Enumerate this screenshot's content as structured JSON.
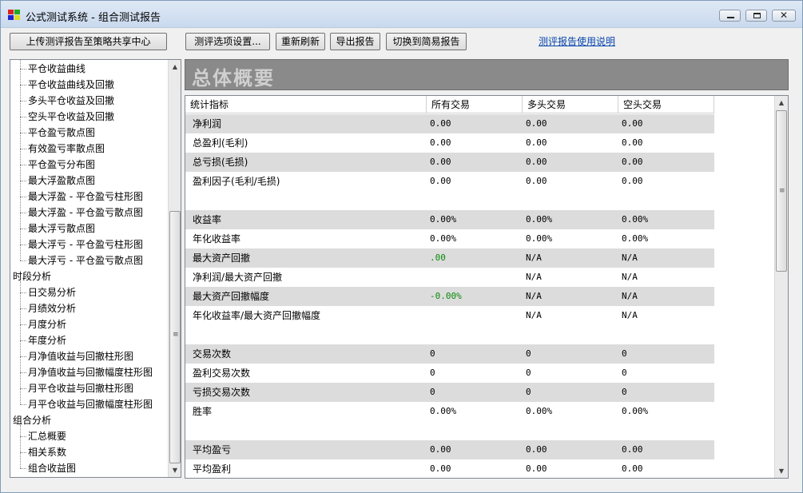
{
  "window": {
    "title": "公式测试系统 - 组合测试报告"
  },
  "toolbar": {
    "upload": "上传测评报告至策略共享中心",
    "options": "测评选项设置...",
    "refresh": "重新刷新",
    "export": "导出报告",
    "switch": "切换到简易报告",
    "help": "测评报告使用说明"
  },
  "tree": {
    "items": [
      {
        "label": "平仓收益曲线",
        "level": 1
      },
      {
        "label": "平仓收益曲线及回撤",
        "level": 1
      },
      {
        "label": "多头平仓收益及回撤",
        "level": 1
      },
      {
        "label": "空头平仓收益及回撤",
        "level": 1
      },
      {
        "label": "平仓盈亏散点图",
        "level": 1
      },
      {
        "label": "有效盈亏率散点图",
        "level": 1
      },
      {
        "label": "平仓盈亏分布图",
        "level": 1
      },
      {
        "label": "最大浮盈散点图",
        "level": 1
      },
      {
        "label": "最大浮盈 - 平仓盈亏柱形图",
        "level": 1
      },
      {
        "label": "最大浮盈 - 平仓盈亏散点图",
        "level": 1
      },
      {
        "label": "最大浮亏散点图",
        "level": 1
      },
      {
        "label": "最大浮亏 - 平仓盈亏柱形图",
        "level": 1
      },
      {
        "label": "最大浮亏 - 平仓盈亏散点图",
        "level": 1
      },
      {
        "label": "时段分析",
        "level": 0
      },
      {
        "label": "日交易分析",
        "level": 1
      },
      {
        "label": "月绩效分析",
        "level": 1
      },
      {
        "label": "月度分析",
        "level": 1
      },
      {
        "label": "年度分析",
        "level": 1
      },
      {
        "label": "月净值收益与回撤柱形图",
        "level": 1
      },
      {
        "label": "月净值收益与回撤幅度柱形图",
        "level": 1
      },
      {
        "label": "月平仓收益与回撤柱形图",
        "level": 1
      },
      {
        "label": "月平仓收益与回撤幅度柱形图",
        "level": 1
      },
      {
        "label": "组合分析",
        "level": 0
      },
      {
        "label": "汇总概要",
        "level": 1
      },
      {
        "label": "相关系数",
        "level": 1
      },
      {
        "label": "组合收益图",
        "level": 1
      }
    ]
  },
  "report": {
    "title": "总体概要",
    "columns": [
      "统计指标",
      "所有交易",
      "多头交易",
      "空头交易"
    ],
    "rows": [
      {
        "label": "净利润",
        "all": "0.00",
        "long": "0.00",
        "short": "0.00",
        "gray": true
      },
      {
        "label": "总盈利(毛利)",
        "all": "0.00",
        "long": "0.00",
        "short": "0.00",
        "gray": false
      },
      {
        "label": "总亏损(毛损)",
        "all": "0.00",
        "long": "0.00",
        "short": "0.00",
        "gray": true
      },
      {
        "label": "盈利因子(毛利/毛损)",
        "all": "0.00",
        "long": "0.00",
        "short": "0.00",
        "gray": false
      },
      {
        "label": "",
        "all": "",
        "long": "",
        "short": "",
        "gray": false
      },
      {
        "label": "收益率",
        "all": "0.00%",
        "long": "0.00%",
        "short": "0.00%",
        "gray": true
      },
      {
        "label": "年化收益率",
        "all": "0.00%",
        "long": "0.00%",
        "short": "0.00%",
        "gray": false
      },
      {
        "label": "最大资产回撤",
        "all": ".00",
        "long": "N/A",
        "short": "N/A",
        "gray": true,
        "green": true
      },
      {
        "label": "净利润/最大资产回撤",
        "all": "",
        "long": "N/A",
        "short": "N/A",
        "gray": false
      },
      {
        "label": "最大资产回撤幅度",
        "all": "-0.00%",
        "long": "N/A",
        "short": "N/A",
        "gray": true,
        "green": true
      },
      {
        "label": "年化收益率/最大资产回撤幅度",
        "all": "",
        "long": "N/A",
        "short": "N/A",
        "gray": false
      },
      {
        "label": "",
        "all": "",
        "long": "",
        "short": "",
        "gray": false
      },
      {
        "label": "交易次数",
        "all": "0",
        "long": "0",
        "short": "0",
        "gray": true
      },
      {
        "label": "盈利交易次数",
        "all": "0",
        "long": "0",
        "short": "0",
        "gray": false
      },
      {
        "label": "亏损交易次数",
        "all": "0",
        "long": "0",
        "short": "0",
        "gray": true
      },
      {
        "label": "胜率",
        "all": "0.00%",
        "long": "0.00%",
        "short": "0.00%",
        "gray": false
      },
      {
        "label": "",
        "all": "",
        "long": "",
        "short": "",
        "gray": false
      },
      {
        "label": "平均盈亏",
        "all": "0.00",
        "long": "0.00",
        "short": "0.00",
        "gray": true
      },
      {
        "label": "平均盈利",
        "all": "0.00",
        "long": "0.00",
        "short": "0.00",
        "gray": false
      }
    ]
  }
}
